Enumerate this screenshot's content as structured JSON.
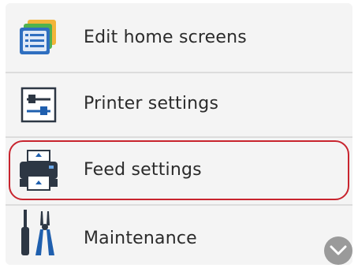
{
  "menu": {
    "items": [
      {
        "label": "Edit home screens",
        "icon": "edit-home-screens-icon"
      },
      {
        "label": "Printer settings",
        "icon": "printer-settings-icon"
      },
      {
        "label": "Feed settings",
        "icon": "feed-settings-icon",
        "highlighted": true
      },
      {
        "label": "Maintenance",
        "icon": "maintenance-icon"
      }
    ]
  },
  "scroll": {
    "icon": "chevron-down-icon"
  },
  "colors": {
    "highlight_outline": "#c8242e",
    "icon_blue": "#1f5fae",
    "icon_dark": "#2d3744",
    "panel_bg": "#f4f4f4",
    "scroll_button": "#9a9a9a"
  }
}
